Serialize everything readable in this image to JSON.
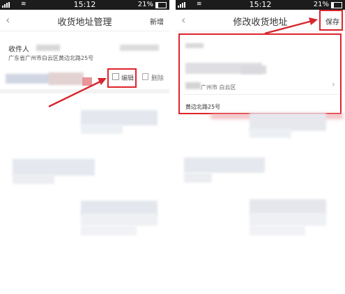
{
  "status_bar": {
    "time": "15:12",
    "battery": "21%",
    "battery_level": 0.21
  },
  "left_screen": {
    "back_icon": "chevron-left-icon",
    "title": "收货地址管理",
    "add_label": "新增",
    "recipient_label": "收件人",
    "address": "广东省广州市白云区黄边北路25号",
    "edit_label": "编辑",
    "delete_label": "删除"
  },
  "right_screen": {
    "back_icon": "chevron-left-icon",
    "title": "修改收货地址",
    "save_label": "保存",
    "region_partial": "广州市 白云区",
    "street_address": "黄边北路25号"
  },
  "colors": {
    "highlight": "#e0232c",
    "status_bar": "#1c1c1c"
  }
}
